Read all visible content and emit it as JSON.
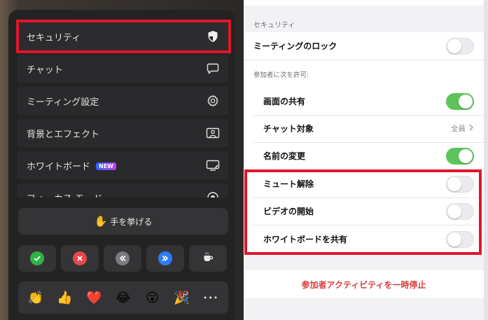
{
  "left_menu": {
    "items": [
      {
        "label": "セキュリティ",
        "icon": "shield-icon"
      },
      {
        "label": "チャット",
        "icon": "chat-bubble-icon"
      },
      {
        "label": "ミーティング設定",
        "icon": "gear-icon"
      },
      {
        "label": "背景とエフェクト",
        "icon": "portrait-frame-icon"
      },
      {
        "label": "ホワイトボード",
        "badge": "NEW",
        "icon": "whiteboard-icon"
      },
      {
        "label": "フォーカス モード",
        "icon": "focus-target-icon"
      }
    ],
    "raise_hand": {
      "emoji": "✋",
      "label": "手を挙げる"
    },
    "reactions": [
      {
        "icon": "yes-check-icon",
        "color": "#2fb344"
      },
      {
        "icon": "no-x-icon",
        "color": "#e5484d"
      },
      {
        "icon": "slower-rewind-icon",
        "color": "#7a7a80"
      },
      {
        "icon": "faster-forward-icon",
        "color": "#2d7cf6"
      },
      {
        "icon": "coffee-cup-icon",
        "color": "#e8e8e8"
      }
    ],
    "emojis": [
      "👏",
      "👍",
      "❤️",
      "😂",
      "😮",
      "🎉"
    ],
    "more_label": "•••"
  },
  "right_panel": {
    "section_header": "セキュリティ",
    "lock_meeting": {
      "label": "ミーティングのロック",
      "on": false
    },
    "allow_header": "参加者に次を許可:",
    "permissions": [
      {
        "label": "画面の共有",
        "type": "toggle",
        "on": true
      },
      {
        "label": "チャット対象",
        "type": "link",
        "value": "全員"
      },
      {
        "label": "名前の変更",
        "type": "toggle",
        "on": true
      },
      {
        "label": "ミュート解除",
        "type": "toggle",
        "on": false
      },
      {
        "label": "ビデオの開始",
        "type": "toggle",
        "on": false
      },
      {
        "label": "ホワイトボードを共有",
        "type": "toggle",
        "on": false
      }
    ],
    "pause_activity": "参加者アクティビティを一時停止"
  },
  "colors": {
    "highlight": "#e1162c",
    "toggle_on": "#5cc45a",
    "danger_text": "#d93c3c"
  }
}
